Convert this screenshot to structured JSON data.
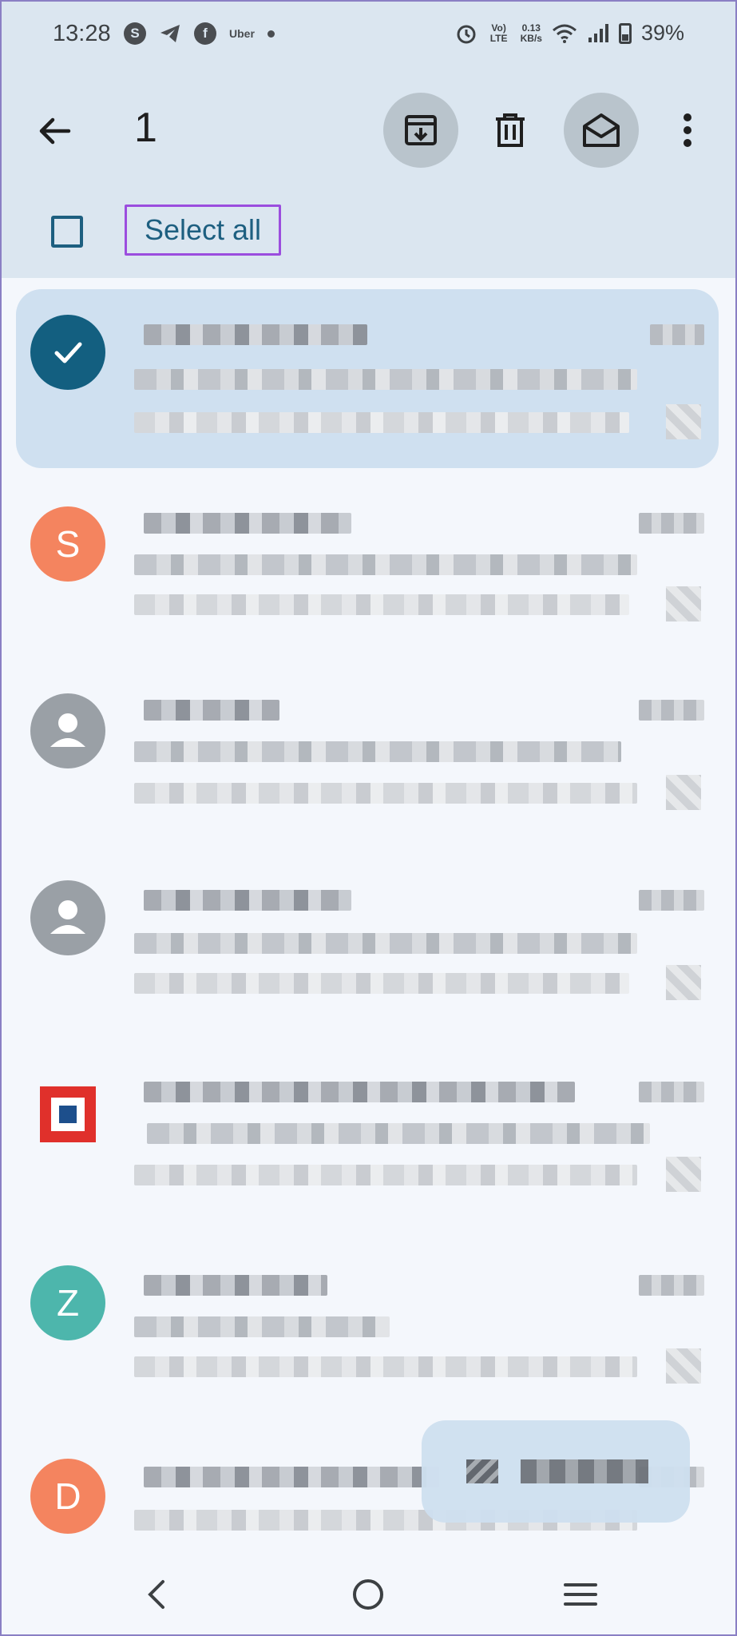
{
  "status_bar": {
    "time": "13:28",
    "apps": [
      "S",
      "telegram",
      "f",
      "Uber"
    ],
    "network": "Vo) LTE",
    "speed_value": "0.13",
    "speed_unit": "KB/s",
    "battery": "39%"
  },
  "app_bar": {
    "selected_count": "1",
    "select_all_label": "Select all",
    "icons": [
      "back-arrow-icon",
      "archive-icon",
      "delete-icon",
      "mark-read-icon",
      "more-vert-icon"
    ]
  },
  "emails": [
    {
      "avatar": "",
      "state": "selected"
    },
    {
      "avatar": "S",
      "color": "#f4845f"
    },
    {
      "avatar": "",
      "type": "person"
    },
    {
      "avatar": "",
      "type": "person"
    },
    {
      "avatar": "",
      "type": "bank-logo"
    },
    {
      "avatar": "Z",
      "color": "#4db6ac"
    },
    {
      "avatar": "D",
      "color": "#f4845f"
    }
  ],
  "colors": {
    "app_bar_bg": "#dbe6f0",
    "accent": "#1d5f80",
    "select_all_highlight": "#9b4dde",
    "selected_row_bg": "#cfe0f0"
  },
  "nav_bar": {
    "icons": [
      "nav-back-icon",
      "nav-home-icon",
      "nav-recents-icon"
    ]
  }
}
